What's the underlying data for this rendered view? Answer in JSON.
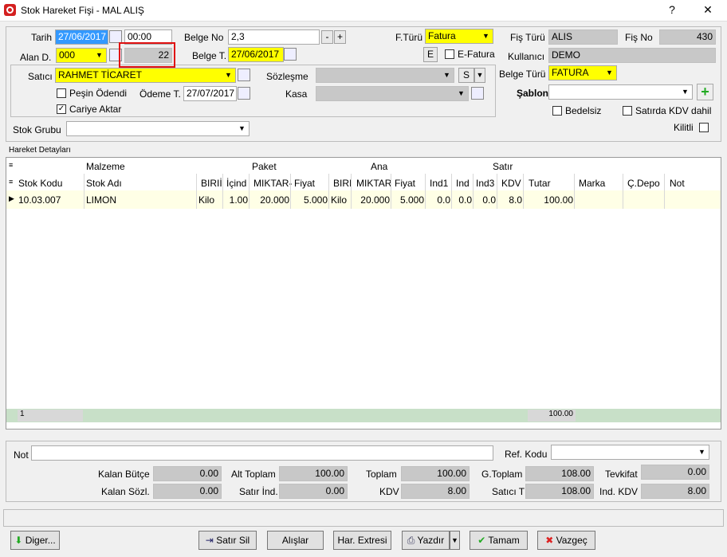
{
  "window": {
    "title": "Stok Hareket Fişi - MAL ALIŞ",
    "help": "?",
    "close": "✕"
  },
  "form": {
    "tarih_label": "Tarih",
    "tarih": "27/06/2017",
    "saat": "00:00",
    "alan_label": "Alan D.",
    "alan": "000",
    "alan_num": "22",
    "belgeno_label": "Belge No",
    "belgeno": "2,3",
    "minus": "-",
    "plus": "+",
    "belget_label": "Belge T.",
    "belget": "27/06/2017",
    "fturu_label": "F.Türü",
    "fturu": "Fatura",
    "e_btn": "E",
    "efatura_label": "E-Fatura",
    "fisturu_label": "Fiş Türü",
    "fisturu": "ALIS",
    "fisno_label": "Fiş No",
    "fisno": "430",
    "kullanici_label": "Kullanıcı",
    "kullanici": "DEMO",
    "satici_label": "Satıcı",
    "satici": "RAHMET TİCARET",
    "sozlesme_label": "Sözleşme",
    "s_btn": "S",
    "pesin_label": "Peşin Ödendi",
    "odemet_label": "Ödeme T.",
    "odemet": "27/07/2017",
    "kasa_label": "Kasa",
    "cariye_label": "Cariye Aktar",
    "belgeturu_label": "Belge Türü",
    "belgeturu": "FATURA",
    "sablon_label": "Şablon",
    "bedelsiz_label": "Bedelsiz",
    "kdvdahil_label": "Satırda KDV dahil",
    "kilitli_label": "Kilitli",
    "stokgrubu_label": "Stok Grubu"
  },
  "grid": {
    "title": "Hareket Detayları",
    "groups": {
      "malzeme": "Malzeme",
      "paket": "Paket",
      "ana": "Ana",
      "satir": "Satır"
    },
    "cols": [
      "Stok Kodu",
      "Stok Adı",
      "BIRIİ",
      "İçind",
      "MIKTAR-",
      "Fiyat",
      "BIRI",
      "MIKTAR",
      "Fiyat",
      "Ind1",
      "Ind",
      "Ind3",
      "KDV",
      "Tutar",
      "Marka",
      "Ç.Depo",
      "Not"
    ],
    "row": [
      "10.03.007",
      "LIMON",
      "Kilo",
      "1.00",
      "20.000",
      "5.000",
      "Kilo",
      "20.000",
      "5.000",
      "0.0",
      "0.0",
      "0.0",
      "8.0",
      "100.00",
      "",
      "",
      ""
    ],
    "footer_count": "1",
    "footer_total": "100.00"
  },
  "totals": {
    "not_label": "Not",
    "refkodu_label": "Ref. Kodu",
    "kalanbutce_label": "Kalan Bütçe",
    "kalanbutce": "0.00",
    "kalansozl_label": "Kalan Sözl.",
    "kalansozl": "0.00",
    "alttoplam_label": "Alt Toplam",
    "alttoplam": "100.00",
    "satirind_label": "Satır İnd.",
    "satirind": "0.00",
    "toplam_label": "Toplam",
    "toplam": "100.00",
    "kdv_label": "KDV",
    "kdv": "8.00",
    "gtoplam_label": "G.Toplam",
    "gtoplam": "108.00",
    "saticit_label": "Satıcı T",
    "saticit": "108.00",
    "tevkifat_label": "Tevkifat",
    "tevkifat": "0.00",
    "indkdv_label": "Ind. KDV",
    "indkdv": "8.00"
  },
  "buttons": {
    "diger": "Diger...",
    "satirsil": "Satır Sil",
    "alislar": "Alışlar",
    "harextresi": "Har. Extresi",
    "yazdir": "Yazdır",
    "tamam": "Tamam",
    "vazgec": "Vazgeç"
  },
  "colors": {
    "yellow": "#ffff00",
    "highlight": "#3399ff",
    "red_frame": "#e01010"
  }
}
